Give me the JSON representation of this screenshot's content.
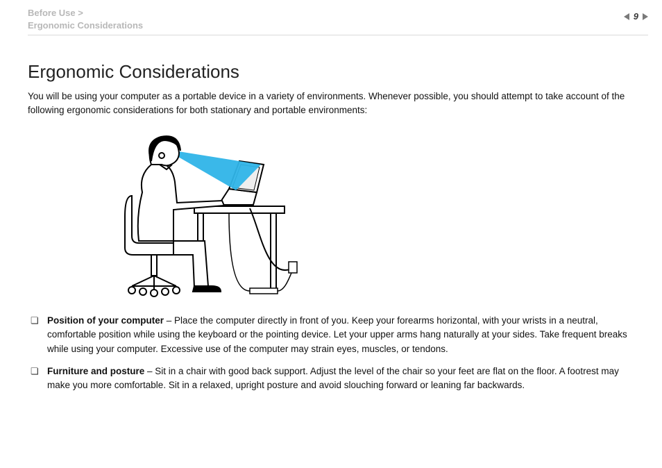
{
  "header": {
    "breadcrumb_line1": "Before Use >",
    "breadcrumb_line2": "Ergonomic Considerations",
    "page_number": "9"
  },
  "body": {
    "title": "Ergonomic Considerations",
    "intro": "You will be using your computer as a portable device in a variety of environments. Whenever possible, you should attempt to take account of the following ergonomic considerations for both stationary and portable environments:",
    "bullets": [
      {
        "lead": "Position of your computer",
        "text": " – Place the computer directly in front of you. Keep your forearms horizontal, with your wrists in a neutral, comfortable position while using the keyboard or the pointing device. Let your upper arms hang naturally at your sides. Take frequent breaks while using your computer. Excessive use of the computer may strain eyes, muscles, or tendons."
      },
      {
        "lead": "Furniture and posture",
        "text": " – Sit in a chair with good back support. Adjust the level of the chair so your feet are flat on the floor. A footrest may make you more comfortable. Sit in a relaxed, upright posture and avoid slouching forward or leaning far backwards."
      }
    ]
  }
}
